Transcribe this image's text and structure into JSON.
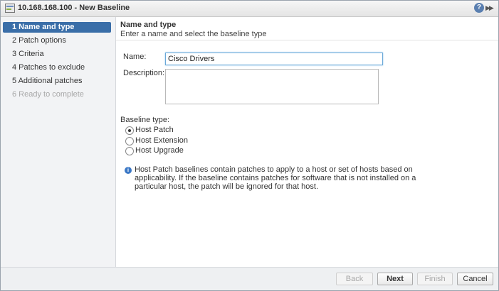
{
  "window": {
    "title": "10.168.168.100 - New Baseline",
    "help_label": "?",
    "expand_label": "▶▶"
  },
  "steps": [
    {
      "label": "1  Name and type",
      "state": "active"
    },
    {
      "label": "2  Patch options",
      "state": "normal"
    },
    {
      "label": "3  Criteria",
      "state": "normal"
    },
    {
      "label": "4  Patches to exclude",
      "state": "normal"
    },
    {
      "label": "5  Additional patches",
      "state": "normal"
    },
    {
      "label": "6  Ready to complete",
      "state": "disabled"
    }
  ],
  "header": {
    "title": "Name and type",
    "subtitle": "Enter a name and select the baseline type"
  },
  "form": {
    "name_label": "Name:",
    "name_value": "Cisco Drivers",
    "description_label": "Description:",
    "description_value": "",
    "baseline_type_label": "Baseline type:",
    "baseline_types": [
      {
        "label": "Host Patch",
        "checked": true
      },
      {
        "label": "Host Extension",
        "checked": false
      },
      {
        "label": "Host Upgrade",
        "checked": false
      }
    ]
  },
  "info": {
    "icon": "info-icon",
    "text": "Host Patch baselines contain patches to apply to a host or set of hosts based on applicability. If the baseline contains patches for software that is not installed on a particular host, the patch will be ignored for that host."
  },
  "footer": {
    "back_label": "Back",
    "next_label": "Next",
    "finish_label": "Finish",
    "cancel_label": "Cancel"
  },
  "colors": {
    "active_step": "#3a6ea8",
    "info_icon": "#3b78c6",
    "input_focus": "#6aa8d8"
  }
}
